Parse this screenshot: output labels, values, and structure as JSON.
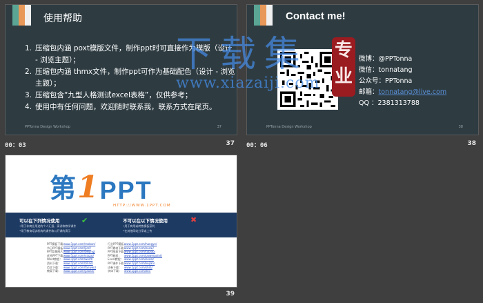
{
  "slides": [
    {
      "time": "00：03",
      "number": "37",
      "title": "使用帮助",
      "items": [
        {
          "n": "1.",
          "text": "压缩包内涵 poxt模版文件，制作ppt时可直接作为模版（设计 - 浏览主题）；"
        },
        {
          "n": "2.",
          "text": "压缩包内涵 thmx文件，制作ppt可作为基础配色（设计 - 浏览主题）；"
        },
        {
          "n": "3.",
          "text": "压缩包含“九型人格测试excel表格”，仅供参考；"
        },
        {
          "n": "4.",
          "text": "使用中有任何问题，欢迎随时联系我，联系方式在尾页。"
        }
      ],
      "footer_left": "PPTonna Design Workshop",
      "footer_right": "37"
    },
    {
      "time": "00：06",
      "number": "38",
      "title": "Contact me!",
      "info": [
        {
          "label": "微博：",
          "value": "@PPTonna"
        },
        {
          "label": "微信：",
          "value": "tonnatang"
        },
        {
          "label": "公众号：",
          "value": "PPTonna"
        },
        {
          "label": "邮箱：",
          "value": "tonnatang@live.com"
        },
        {
          "label": "QQ ：",
          "value": "2381313788"
        }
      ],
      "seal_text": [
        "专",
        "业"
      ],
      "footer_left": "PPTonna Design Workshop",
      "footer_right": "38"
    },
    {
      "number": "39",
      "logo": {
        "dai": "第",
        "one": "1",
        "ppt": "PPT",
        "url": "HTTP://WWW.1PPT.COM"
      },
      "allowed_title": "可以在下列情况使用",
      "allowed_lines": [
        "•用于非商业用途的个人汇报、演讲和教学课件",
        "•用于教育培训机构的课件和公开课的演示"
      ],
      "forbidden_title": "不可以在以下情况使用",
      "forbidden_lines": [
        "•用于商用或转售模板获利",
        "•在其他网站分享或上传"
      ],
      "links_left": [
        {
          "label": "PPT模板下载：",
          "url": "www.1ppt.com/moban/"
        },
        {
          "label": "节日PPT模板：",
          "url": "www.1ppt.com/jieri/"
        },
        {
          "label": "PPT背景图片：",
          "url": "www.1ppt.com/beijing/"
        },
        {
          "label": "优秀PPT下载：",
          "url": "www.1ppt.com/xiazai/"
        },
        {
          "label": "Word教程：",
          "url": "www.1ppt.com/word/"
        },
        {
          "label": "资料下载：",
          "url": "www.1ppt.com/ziliao/"
        },
        {
          "label": "范文下载：",
          "url": "www.1ppt.com/fanwen/"
        },
        {
          "label": "教案下载：",
          "url": "www.1ppt.com/jiaoan/"
        }
      ],
      "links_right": [
        {
          "label": "行业PPT模板：",
          "url": "www.1ppt.com/hangye/"
        },
        {
          "label": "PPT素材下载：",
          "url": "www.1ppt.com/sucai/"
        },
        {
          "label": "PPT图表下载：",
          "url": "www.1ppt.com/tubiao/"
        },
        {
          "label": "PPT教程：",
          "url": "www.1ppt.com/powerpoint/"
        },
        {
          "label": "Excel教程：",
          "url": "www.1ppt.com/excel/"
        },
        {
          "label": "PPT课件下载：",
          "url": "www.1ppt.com/kejian/"
        },
        {
          "label": "试卷下载：",
          "url": "www.1ppt.com/shiti/"
        },
        {
          "label": "字体下载：",
          "url": "www.1ppt.com/ziti/"
        }
      ]
    }
  ],
  "watermark": {
    "text": "下载集",
    "url": "www.xiazaiji.com",
    "seal": "专业"
  },
  "colors": {
    "background": "#3f3f3f",
    "slide_dark": "#2e3c42",
    "stripe_green": "#5aa594",
    "stripe_orange": "#e89858",
    "brand_blue": "#2b77c0",
    "brand_orange": "#ef7d22",
    "band_navy": "#1d3a63"
  }
}
